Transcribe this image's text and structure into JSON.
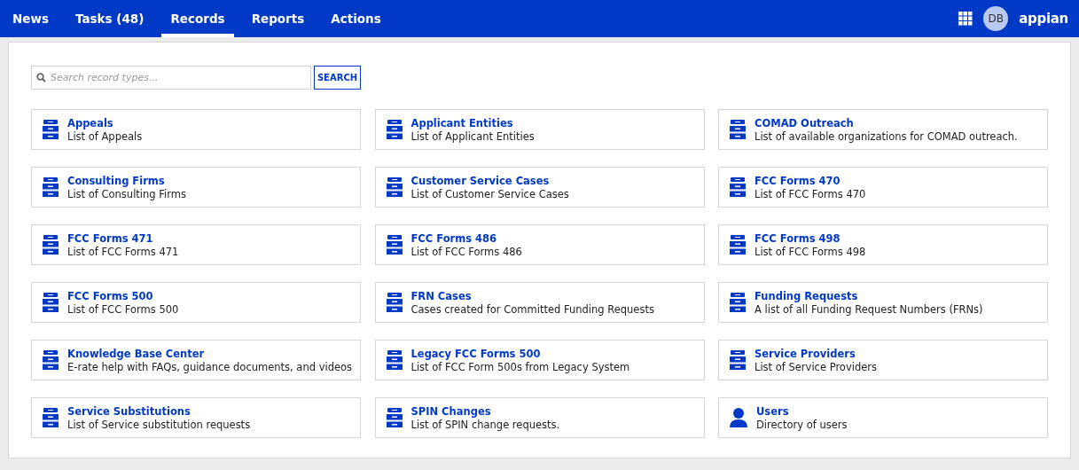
{
  "nav": {
    "tabs": [
      {
        "label": "News",
        "selected": false
      },
      {
        "label": "Tasks (48)",
        "selected": false
      },
      {
        "label": "Records",
        "selected": true
      },
      {
        "label": "Reports",
        "selected": false
      },
      {
        "label": "Actions",
        "selected": false
      }
    ],
    "avatar": "DB",
    "logo": "appian"
  },
  "search": {
    "placeholder": "Search record types...",
    "button": "SEARCH"
  },
  "records": [
    {
      "title": "Appeals",
      "description": "List of Appeals",
      "kind": "cabinet"
    },
    {
      "title": "Applicant Entities",
      "description": "List of Applicant Entities",
      "kind": "cabinet"
    },
    {
      "title": "COMAD Outreach",
      "description": "List of available organizations for COMAD outreach.",
      "kind": "cabinet"
    },
    {
      "title": "Consulting Firms",
      "description": "List of Consulting Firms",
      "kind": "cabinet"
    },
    {
      "title": "Customer Service Cases",
      "description": "List of Customer Service Cases",
      "kind": "cabinet"
    },
    {
      "title": "FCC Forms 470",
      "description": "List of FCC Forms 470",
      "kind": "cabinet"
    },
    {
      "title": "FCC Forms 471",
      "description": "List of FCC Forms 471",
      "kind": "cabinet"
    },
    {
      "title": "FCC Forms 486",
      "description": "List of FCC Forms 486",
      "kind": "cabinet"
    },
    {
      "title": "FCC Forms 498",
      "description": "List of FCC Forms 498",
      "kind": "cabinet"
    },
    {
      "title": "FCC Forms 500",
      "description": "List of FCC Forms 500",
      "kind": "cabinet"
    },
    {
      "title": "FRN Cases",
      "description": "Cases created for Committed Funding Requests",
      "kind": "cabinet"
    },
    {
      "title": "Funding Requests",
      "description": "A list of all Funding Request Numbers (FRNs)",
      "kind": "cabinet"
    },
    {
      "title": "Knowledge Base Center",
      "description": "E-rate help with FAQs, guidance documents, and videos",
      "kind": "cabinet"
    },
    {
      "title": "Legacy FCC Forms 500",
      "description": "List of FCC Form 500s from Legacy System",
      "kind": "cabinet"
    },
    {
      "title": "Service Providers",
      "description": "List of Service Providers",
      "kind": "cabinet"
    },
    {
      "title": "Service Substitutions",
      "description": "List of Service substitution requests",
      "kind": "cabinet"
    },
    {
      "title": "SPIN Changes",
      "description": "List of SPIN change requests.",
      "kind": "cabinet"
    },
    {
      "title": "Users",
      "description": "Directory of users",
      "kind": "user"
    }
  ]
}
